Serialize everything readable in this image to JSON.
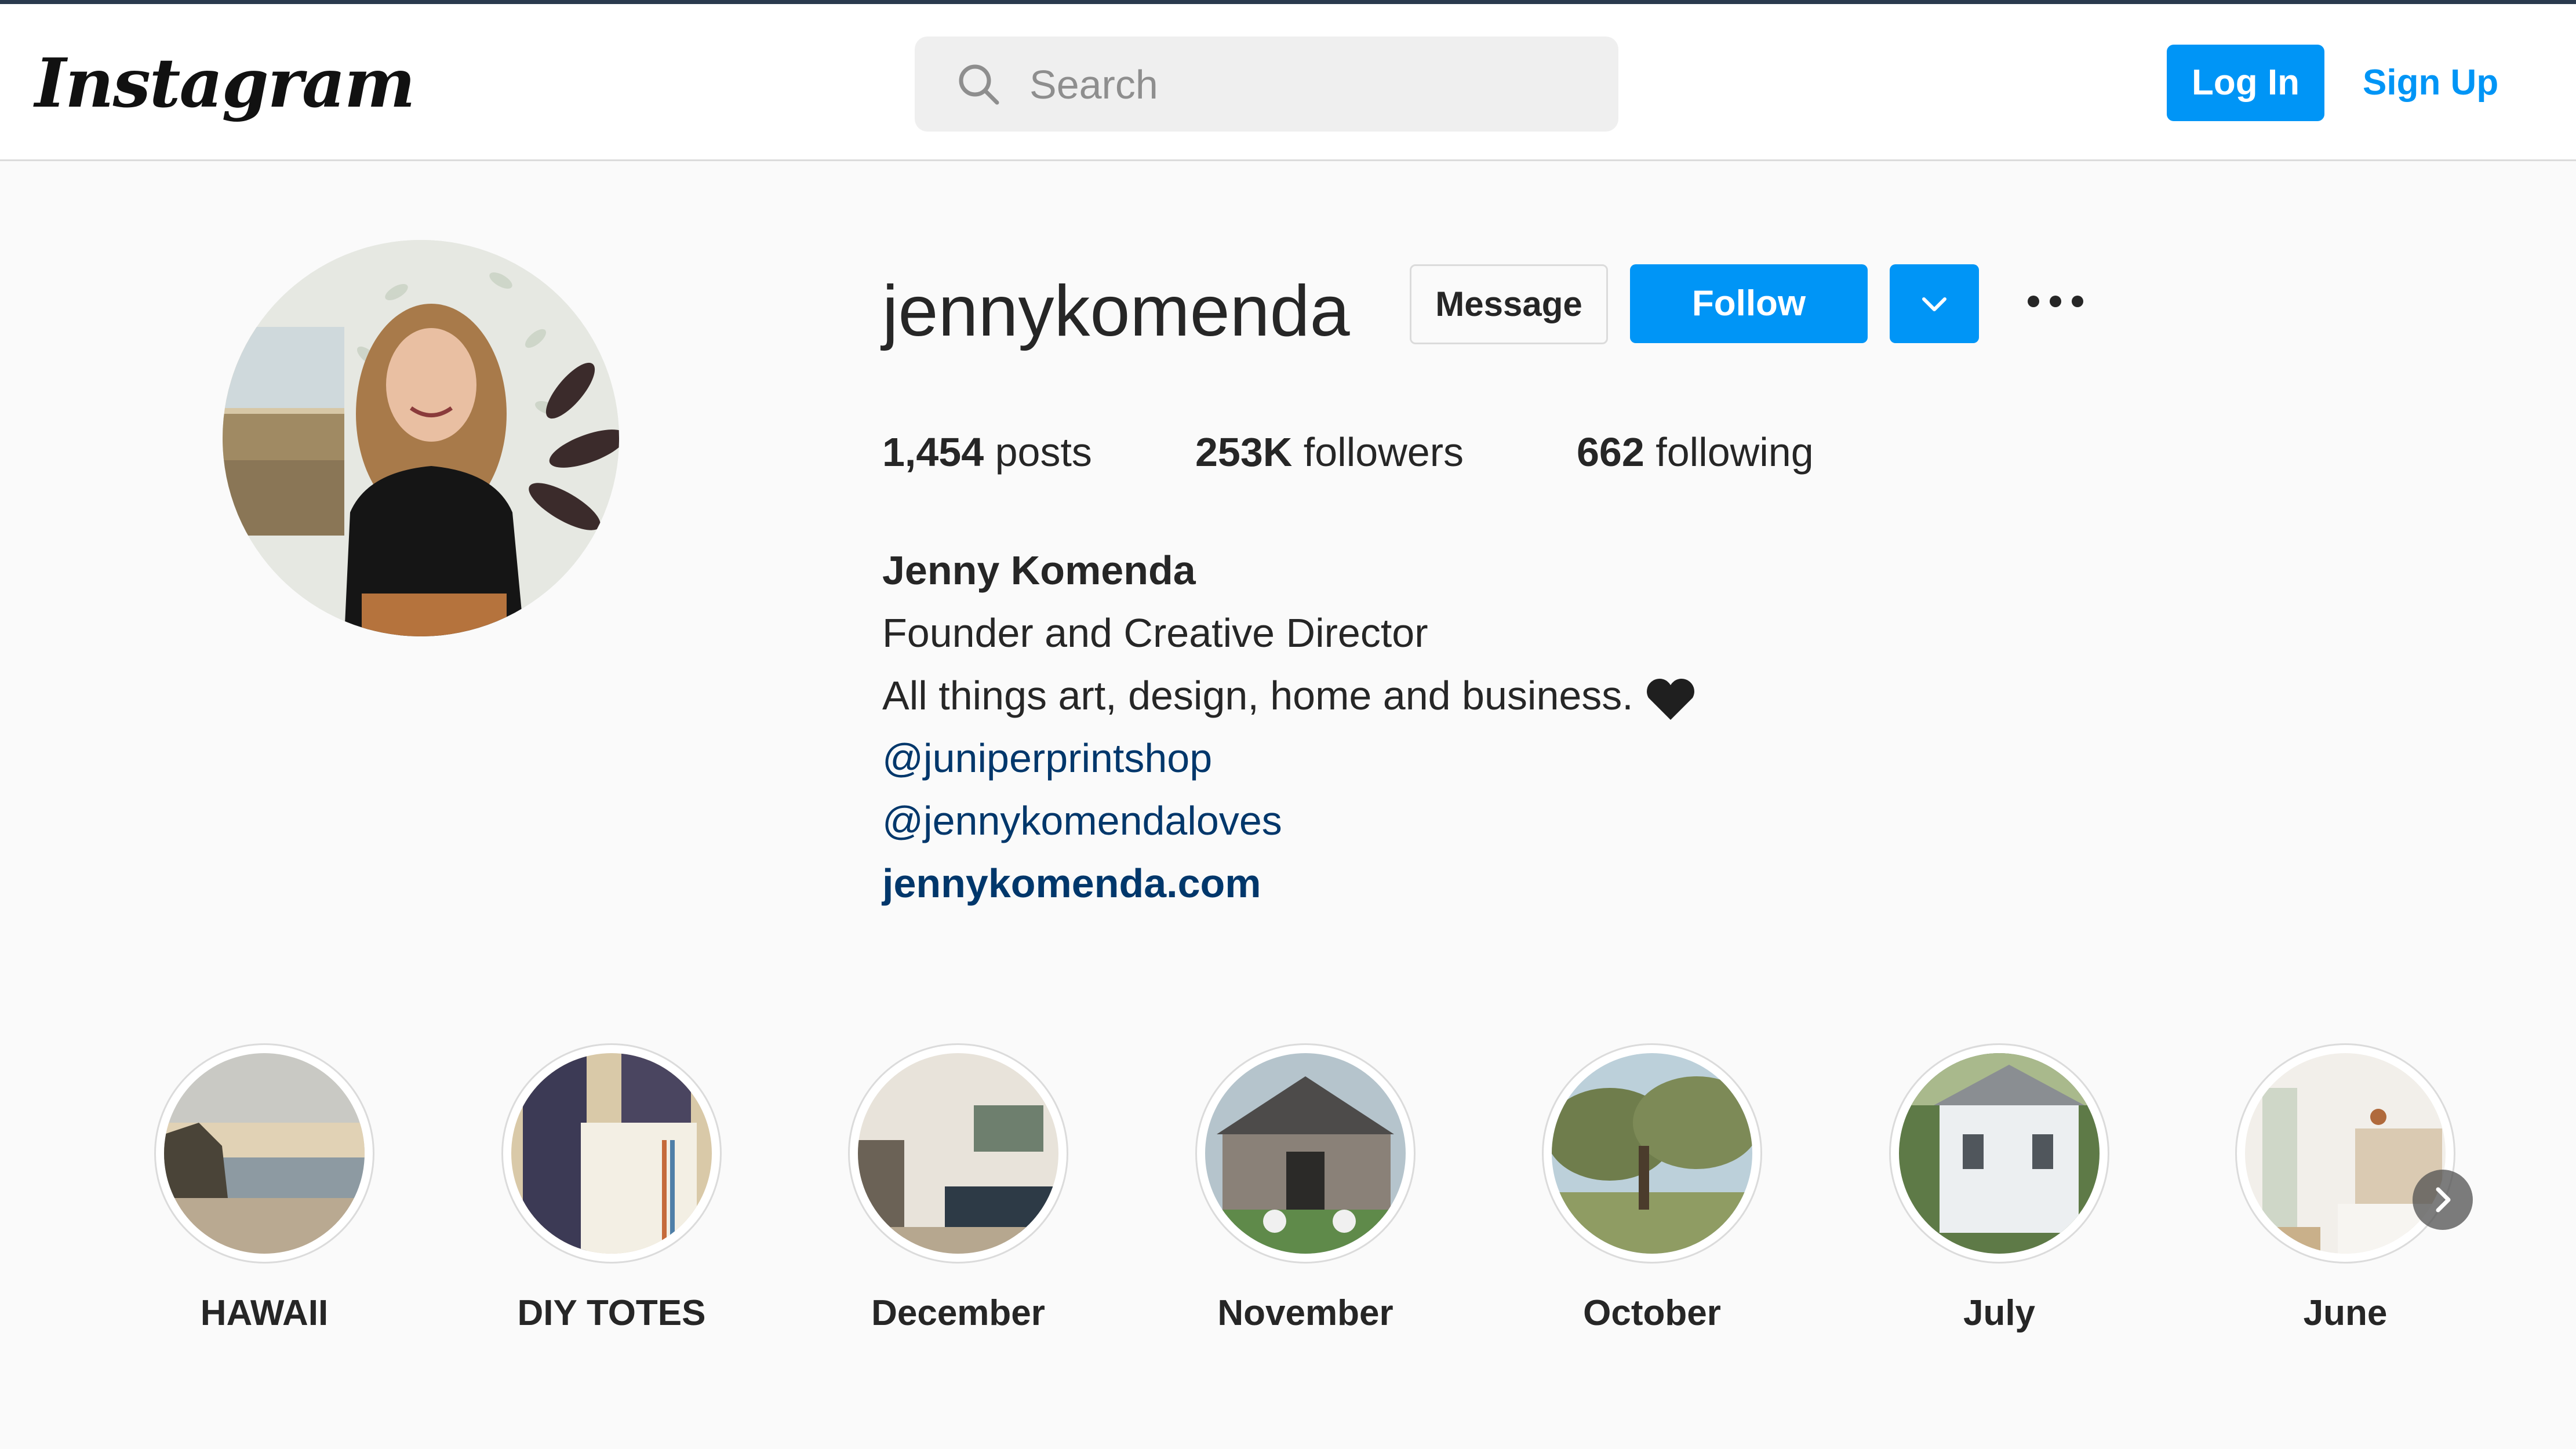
{
  "header": {
    "logo_text": "Instagram",
    "search": {
      "placeholder": "Search"
    },
    "login_label": "Log In",
    "signup_label": "Sign Up"
  },
  "profile": {
    "username": "jennykomenda",
    "message_label": "Message",
    "follow_label": "Follow",
    "stats": {
      "posts_count": "1,454",
      "posts_label": "posts",
      "followers_count": "253K",
      "followers_label": "followers",
      "following_count": "662",
      "following_label": "following"
    },
    "bio": {
      "full_name": "Jenny Komenda",
      "line1": "Founder and Creative Director",
      "line2": "All things art, design, home and business.",
      "mention1": "@juniperprintshop",
      "mention2": "@jennykomendaloves",
      "website": "jennykomenda.com"
    }
  },
  "highlights": [
    {
      "label": "HAWAII"
    },
    {
      "label": "DIY TOTES"
    },
    {
      "label": "December"
    },
    {
      "label": "November"
    },
    {
      "label": "October"
    },
    {
      "label": "July"
    },
    {
      "label": "June"
    }
  ],
  "colors": {
    "primary_button": "#0095f6",
    "link": "#00376b",
    "background": "#fafafa"
  },
  "icons": {
    "search": "search-icon",
    "dropdown": "chevron-down-icon",
    "more": "more-options-icon",
    "heart": "black-heart-emoji",
    "next": "chevron-right-icon"
  }
}
